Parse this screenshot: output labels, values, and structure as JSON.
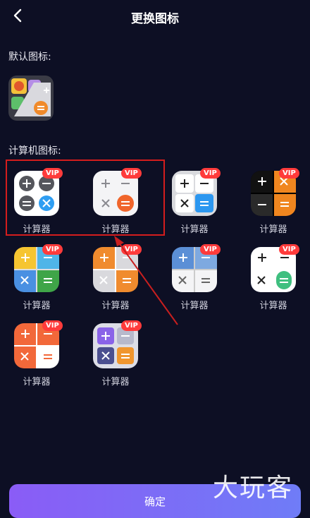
{
  "header": {
    "title": "更换图标",
    "back_icon": "chevron-left-icon"
  },
  "sections": {
    "default_label": "默认图标:",
    "calculator_label": "计算机图标:"
  },
  "icons": [
    {
      "label": "计算器",
      "badge": "VIP",
      "style": "dark-circles"
    },
    {
      "label": "计算器",
      "badge": "VIP",
      "style": "white-orange"
    },
    {
      "label": "计算器",
      "badge": "VIP",
      "style": "white-blue"
    },
    {
      "label": "计算器",
      "badge": "VIP",
      "style": "black-orange"
    },
    {
      "label": "计算器",
      "badge": "VIP",
      "style": "yellow-blue-green"
    },
    {
      "label": "计算器",
      "badge": "VIP",
      "style": "orange-grey"
    },
    {
      "label": "计算器",
      "badge": "VIP",
      "style": "blue-grey"
    },
    {
      "label": "计算器",
      "badge": "VIP",
      "style": "white-green"
    },
    {
      "label": "计算器",
      "badge": "VIP",
      "style": "orange-white"
    },
    {
      "label": "计算器",
      "badge": "VIP",
      "style": "purple-grey"
    }
  ],
  "confirm": {
    "label": "确定"
  },
  "watermark": "大玩客",
  "colors": {
    "background": "#0d0f24",
    "vip": "#ff3b3b",
    "highlight": "#d41d1d",
    "button_start": "#8a5cf6",
    "button_end": "#6f7cf7"
  }
}
